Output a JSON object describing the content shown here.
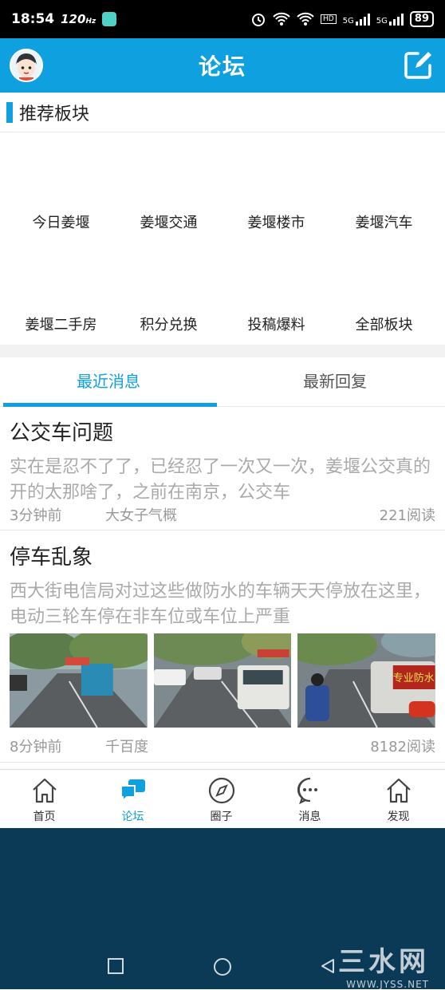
{
  "status_bar": {
    "time": "18:54",
    "refresh_rate": "120",
    "refresh_unit": "Hz",
    "network_5g_a": "5G",
    "network_5g_b": "5G",
    "hd_label": "HD",
    "battery": "89"
  },
  "header": {
    "title": "论坛"
  },
  "recommended": {
    "title": "推荐板块",
    "boards": [
      "今日姜堰",
      "姜堰交通",
      "姜堰楼市",
      "姜堰汽车",
      "姜堰二手房",
      "积分兑换",
      "投稿爆料",
      "全部板块"
    ]
  },
  "tabs": [
    {
      "label": "最近消息",
      "active": true
    },
    {
      "label": "最新回复",
      "active": false
    }
  ],
  "posts": [
    {
      "title": "公交车问题",
      "excerpt": "实在是忍不了了，已经忍了一次又一次，姜堰公交真的开的太那啥了，之前在南京，公交车",
      "time": "3分钟前",
      "author": "大女子气概",
      "reads": "221阅读"
    },
    {
      "title": "停车乱象",
      "excerpt": "西大街电信局对过这些做防水的车辆天天停放在这里，电动三轮车停在非车位或车位上严重",
      "time": "8分钟前",
      "author": "千百度",
      "reads": "8182阅读",
      "thumb_sign_text": "专业防水"
    }
  ],
  "bottom_nav": [
    {
      "label": "首页",
      "icon": "home-icon",
      "active": false
    },
    {
      "label": "论坛",
      "icon": "chat-bubbles-icon",
      "active": true
    },
    {
      "label": "圈子",
      "icon": "compass-icon",
      "active": false
    },
    {
      "label": "消息",
      "icon": "message-dots-icon",
      "active": false
    },
    {
      "label": "发现",
      "icon": "discover-home-icon",
      "active": false
    }
  ],
  "watermark": {
    "brand": "三水网",
    "url": "WWW.JYSS.NET"
  },
  "colors": {
    "accent": "#0fa0e0",
    "system_bg": "#0b3a57"
  }
}
